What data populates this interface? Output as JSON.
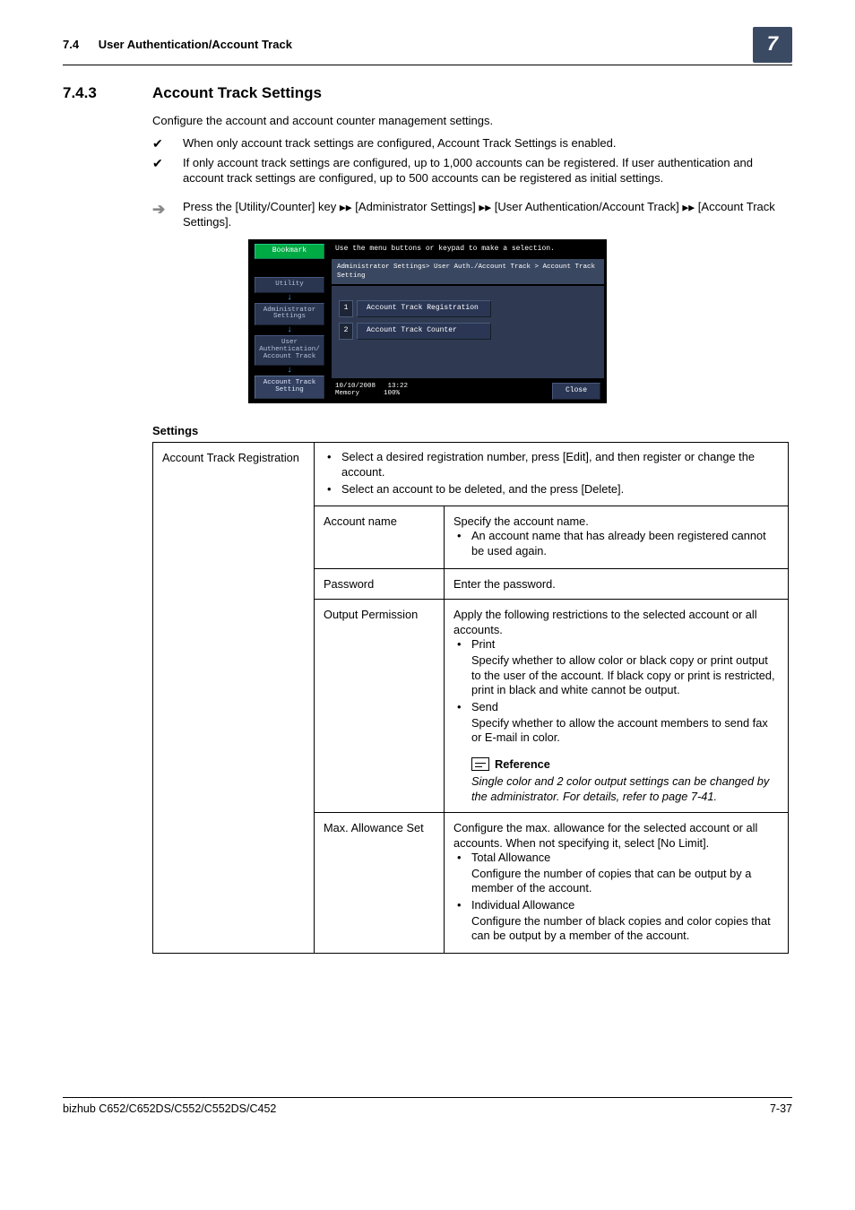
{
  "header": {
    "section_num": "7.4",
    "section_title": "User Authentication/Account Track",
    "chapter_num": "7"
  },
  "heading": {
    "num": "7.4.3",
    "title": "Account Track Settings"
  },
  "intro": "Configure the account and account counter management settings.",
  "checks": {
    "c1": "When only account track settings are configured, Account Track Settings is enabled.",
    "c2": "If only account track settings are configured, up to 1,000 accounts can be registered. If user authentication and account track settings are configured, up to 500 accounts can be registered as initial settings."
  },
  "arrow": {
    "p1": "Press the [Utility/Counter] key ",
    "p2": " [Administrator Settings] ",
    "p3": " [User Authentication/Account Track] ",
    "p4": " [Account Track Settings]."
  },
  "screen": {
    "instr": "Use the menu buttons or keypad to make a selection.",
    "crumb": "Administrator Settings> User Auth./Account Track > Account Track Setting",
    "bookmark": "Bookmark",
    "nav": {
      "n1": "Utility",
      "n2": "Administrator Settings",
      "n3": "User Authentication/ Account Track",
      "n4": "Account Track Setting"
    },
    "menu": {
      "m1n": "1",
      "m1t": "Account Track Registration",
      "m2n": "2",
      "m2t": "Account Track Counter"
    },
    "footer": {
      "date": "10/10/2008",
      "time": "13:22",
      "mem_l": "Memory",
      "mem_v": "100%",
      "close": "Close"
    }
  },
  "settings": {
    "title": "Settings",
    "row1_label": "Account Track Registration",
    "row1_b1": "Select a desired registration number, press [Edit], and then register or change the account.",
    "row1_b2": "Select an account to be deleted, and the press [Delete].",
    "r2a": "Account name",
    "r2b_main": "Specify the account name.",
    "r2b_sub": "An account name that has already been registered cannot be used again.",
    "r3a": "Password",
    "r3b": "Enter the password.",
    "r4a": "Output Permission",
    "r4b_intro": "Apply the following restrictions to the selected account or all accounts.",
    "r4b_p_head": "Print",
    "r4b_p_body": "Specify whether to allow color or black copy or print output to the user of the account. If black copy or print is restricted, print in black and white cannot be output.",
    "r4b_s_head": "Send",
    "r4b_s_body": "Specify whether to allow the account members to send fax or E-mail in color.",
    "r4b_ref_head": "Reference",
    "r4b_ref_body": "Single color and 2 color output settings can be changed by the administrator. For details, refer to page 7-41.",
    "r5a": "Max. Allowance Set",
    "r5b_intro": "Configure the max. allowance for the selected account or all accounts. When not specifying it, select [No Limit].",
    "r5b_t_head": "Total Allowance",
    "r5b_t_body": "Configure the number of copies that can be output by a member of the account.",
    "r5b_i_head": "Individual Allowance",
    "r5b_i_body": "Configure the number of black copies and color copies that can be output by a member of the account."
  },
  "footer": {
    "model": "bizhub C652/C652DS/C552/C552DS/C452",
    "page": "7-37"
  }
}
